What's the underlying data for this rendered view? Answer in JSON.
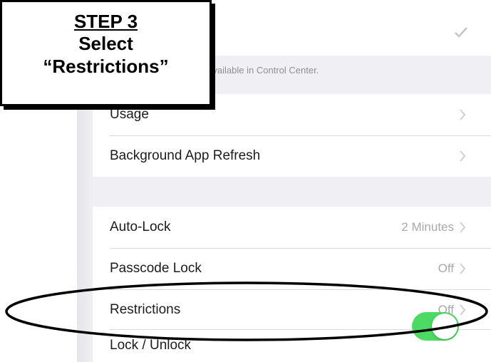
{
  "instruction": {
    "title": "STEP 3",
    "line1": "Select",
    "line2": "“Restrictions”"
  },
  "control_center_footer": "Available in Control Center.",
  "rows": {
    "usage": {
      "label": "Usage"
    },
    "background_refresh": {
      "label": "Background App Refresh"
    },
    "auto_lock": {
      "label": "Auto-Lock",
      "value": "2 Minutes"
    },
    "passcode_lock": {
      "label": "Passcode Lock",
      "value": "Off"
    },
    "restrictions": {
      "label": "Restrictions",
      "value": "Off"
    },
    "lock_unlock": {
      "label": "Lock / Unlock",
      "toggle_on": true
    }
  },
  "colors": {
    "background": "#f0eff4",
    "toggle_on": "#4cd964",
    "value_gray": "#a8a8ad"
  },
  "icons": [
    "check-icon",
    "chevron-right-icon"
  ]
}
